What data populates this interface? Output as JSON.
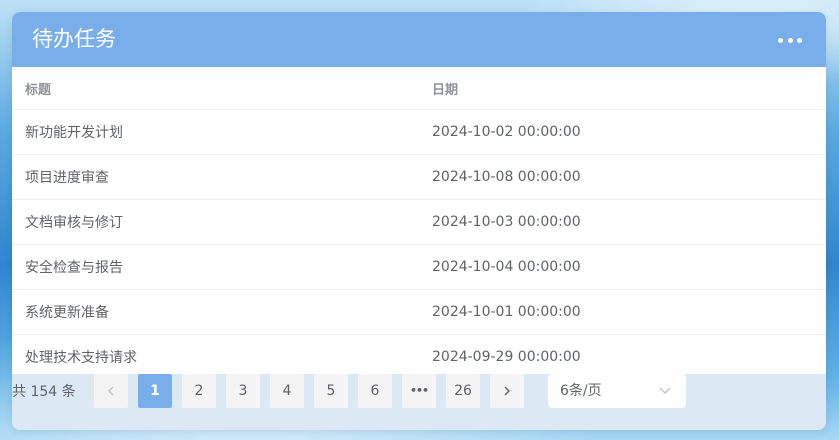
{
  "panel": {
    "title": "待办任务",
    "more_icon": "more-horizontal-icon"
  },
  "table": {
    "columns": [
      "标题",
      "日期"
    ],
    "rows": [
      {
        "title": "新功能开发计划",
        "date": "2024-10-02 00:00:00"
      },
      {
        "title": "项目进度审查",
        "date": "2024-10-08 00:00:00"
      },
      {
        "title": "文档审核与修订",
        "date": "2024-10-03 00:00:00"
      },
      {
        "title": "安全检查与报告",
        "date": "2024-10-04 00:00:00"
      },
      {
        "title": "系统更新准备",
        "date": "2024-10-01 00:00:00"
      },
      {
        "title": "处理技术支持请求",
        "date": "2024-09-29 00:00:00"
      }
    ]
  },
  "pagination": {
    "total_text": "共 154 条",
    "prev_icon": "chevron-left-icon",
    "next_icon": "chevron-right-icon",
    "pages": [
      "1",
      "2",
      "3",
      "4",
      "5",
      "6"
    ],
    "ellipsis": "•••",
    "last_page": "26",
    "current_page": "1",
    "page_size": "6条/页",
    "page_size_icon": "chevron-down-icon"
  }
}
